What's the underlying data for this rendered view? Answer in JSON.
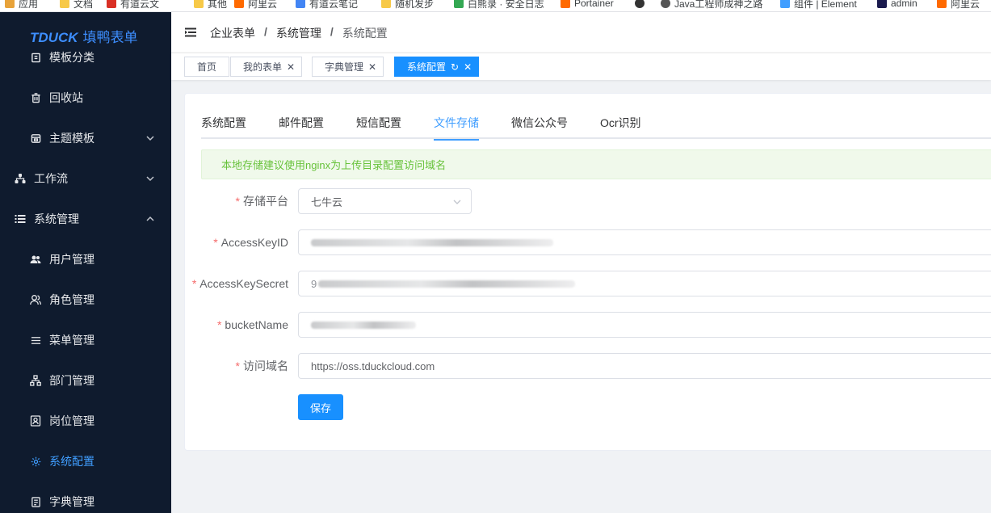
{
  "bookmarks": [
    {
      "label": "应用",
      "color": "#e8a33a"
    },
    {
      "label": "文档",
      "color": "#f7c948"
    },
    {
      "label": "有道云文",
      "color": "#d93025"
    },
    {
      "label": "其他",
      "color": "#f7c948"
    },
    {
      "label": "阿里云",
      "color": "#ff6a00"
    },
    {
      "label": "有道云笔记",
      "color": "#4285f4"
    },
    {
      "label": "随机发步",
      "color": "#f7c948"
    },
    {
      "label": "白熊录 · 安全日志",
      "color": "#34a853"
    },
    {
      "label": "Portainer",
      "color": "#ff6a00"
    },
    {
      "label": "",
      "color": "#333333"
    },
    {
      "label": "Java工程师成神之路",
      "color": "#555555"
    },
    {
      "label": "组件 | Element",
      "color": "#409eff"
    },
    {
      "label": "admin",
      "color": "#1a1a4e"
    },
    {
      "label": "阿里云",
      "color": "#ff6a00"
    }
  ],
  "sidebar": {
    "logo_en": "TDUCK",
    "logo_cn": "填鸭表单",
    "items": [
      {
        "label": "模板分类",
        "icon": "template-category-icon"
      },
      {
        "label": "回收站",
        "icon": "trash-icon"
      },
      {
        "label": "主题模板",
        "icon": "theme-icon"
      },
      {
        "label": "工作流",
        "icon": "workflow-icon"
      },
      {
        "label": "系统管理",
        "icon": "list-icon"
      },
      {
        "label": "用户管理",
        "icon": "user-group-icon"
      },
      {
        "label": "角色管理",
        "icon": "role-icon"
      },
      {
        "label": "菜单管理",
        "icon": "menu-icon"
      },
      {
        "label": "部门管理",
        "icon": "department-icon"
      },
      {
        "label": "岗位管理",
        "icon": "post-icon"
      },
      {
        "label": "系统配置",
        "icon": "settings-icon"
      },
      {
        "label": "字典管理",
        "icon": "dictionary-icon"
      }
    ]
  },
  "breadcrumb": [
    "企业表单",
    "系统管理",
    "系统配置"
  ],
  "tags": [
    "首页",
    "我的表单",
    "字典管理",
    "系统配置"
  ],
  "tabs": [
    "系统配置",
    "邮件配置",
    "短信配置",
    "文件存储",
    "微信公众号",
    "Ocr识别"
  ],
  "alert": "本地存储建议使用nginx为上传目录配置访问域名",
  "form": {
    "platform_label": "存储平台",
    "platform_value": "七牛云",
    "access_key_id_label": "AccessKeyID",
    "access_key_secret_label": "AccessKeySecret",
    "access_key_secret_prefix": "9",
    "bucket_label": "bucketName",
    "domain_label": "访问域名",
    "domain_value": "https://oss.tduckcloud.com",
    "save_label": "保存"
  },
  "colors": {
    "sidebar_bg": "#0f1b2e",
    "accent": "#409eff",
    "primary_button": "#1890ff",
    "alert_text": "#67c23a",
    "required": "#f56c6c"
  }
}
